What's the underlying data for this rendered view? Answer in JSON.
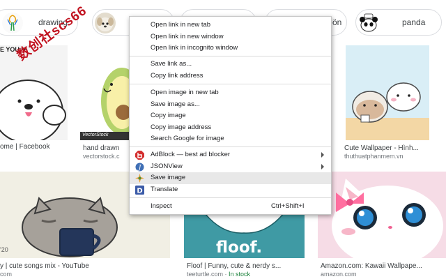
{
  "watermark": "数创社scs66",
  "chips": [
    {
      "label": "drawing"
    },
    {
      "label": ""
    },
    {
      "label": "ön"
    },
    {
      "label": "panda"
    }
  ],
  "results": [
    {
      "caption": "ome | Facebook",
      "source": "",
      "image_text": "E YOU ❤"
    },
    {
      "caption": "hand drawn",
      "source": "vectorstock.c",
      "image_text": "VectorStock"
    },
    {
      "caption": "Cute Wallpaper - Hình...",
      "source": "thuthuatphanmem.vn"
    },
    {
      "caption": "y | cute songs mix - YouTube",
      "source": "com",
      "image_text": "'20"
    },
    {
      "caption": "Floof | Funny, cute & nerdy s...",
      "source": "teeturtle.com",
      "stock": "In stock",
      "source_sep": " · ",
      "image_text": "floof."
    },
    {
      "caption": "Amazon.com: Kawaii Wallpape...",
      "source": "amazon.com"
    }
  ],
  "context_menu": {
    "items": [
      {
        "label": "Open link in new tab"
      },
      {
        "label": "Open link in new window"
      },
      {
        "label": "Open link in incognito window"
      },
      {
        "label": "Save link as..."
      },
      {
        "label": "Copy link address"
      },
      {
        "label": "Open image in new tab"
      },
      {
        "label": "Save image as..."
      },
      {
        "label": "Copy image"
      },
      {
        "label": "Copy image address"
      },
      {
        "label": "Search Google for image"
      },
      {
        "label": "AdBlock — best ad blocker",
        "icon": "adblock-icon",
        "submenu": true
      },
      {
        "label": "JSONView",
        "icon": "jsonview-icon",
        "submenu": true
      },
      {
        "label": "Save image",
        "icon": "save-image-extension-icon",
        "highlighted": true
      },
      {
        "label": "Translate",
        "icon": "translate-icon"
      },
      {
        "label": "Inspect",
        "shortcut": "Ctrl+Shift+I"
      }
    ]
  },
  "colors": {
    "adblock": "#d32f2f",
    "jsonview": "#3f6fb5",
    "translate": "#3b5ba8",
    "highlight": "#e8e8e8"
  }
}
